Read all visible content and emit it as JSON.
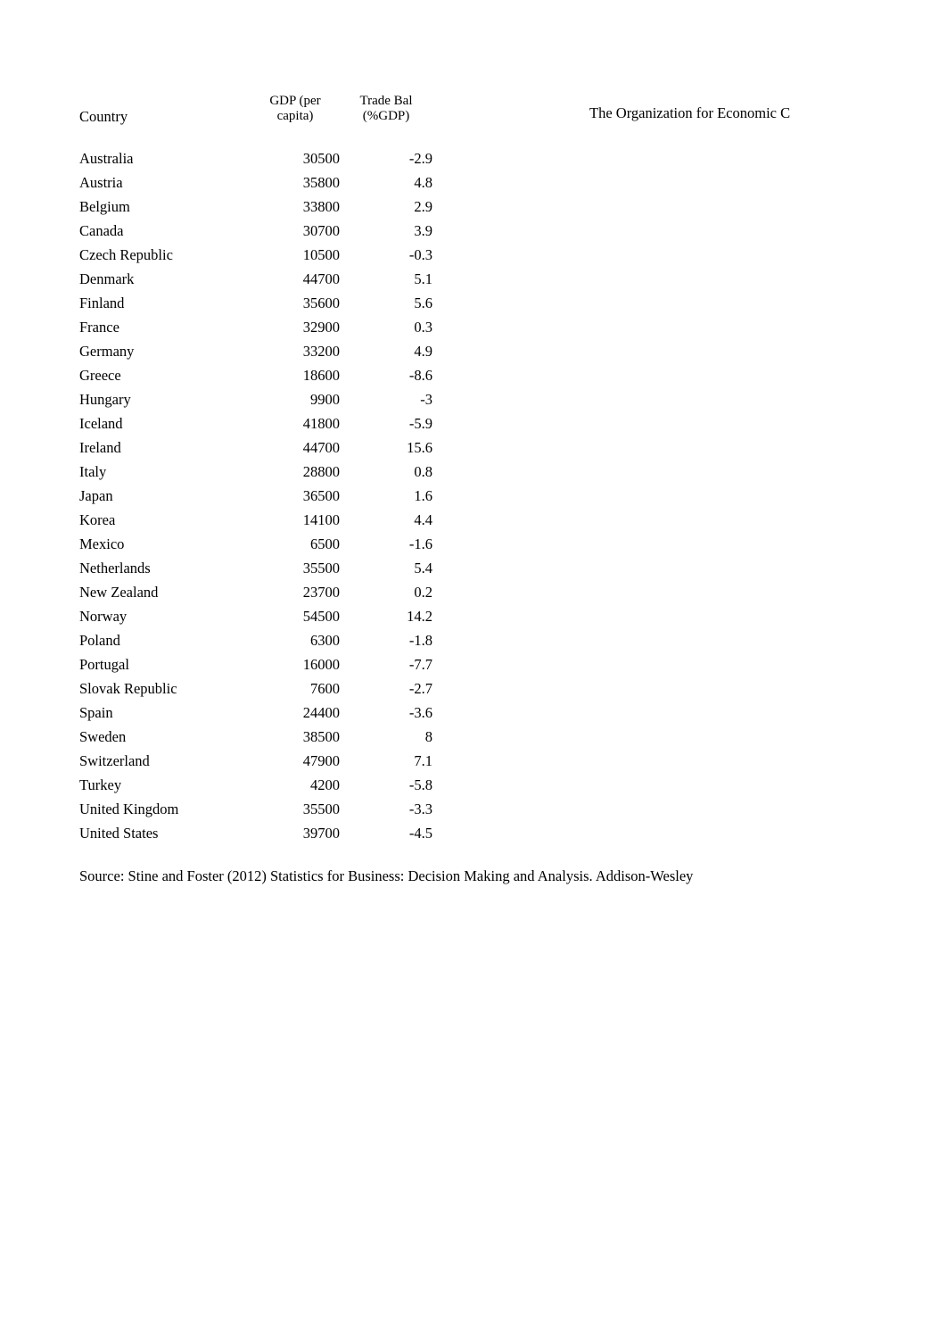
{
  "document": {
    "side_note": "The Organization for Economic C",
    "source": "Source: Stine and Foster (2012) Statistics for Business: Decision Making and Analysis. Addison-Wesley"
  },
  "table": {
    "headers": {
      "country": "Country",
      "gdp_line1": "GDP (per",
      "gdp_line2": "capita)",
      "trade_line1": "Trade Bal",
      "trade_line2": "(%GDP)"
    },
    "rows": [
      {
        "country": "Australia",
        "gdp": "30500",
        "trade": "-2.9"
      },
      {
        "country": "Austria",
        "gdp": "35800",
        "trade": "4.8"
      },
      {
        "country": "Belgium",
        "gdp": "33800",
        "trade": "2.9"
      },
      {
        "country": "Canada",
        "gdp": "30700",
        "trade": "3.9"
      },
      {
        "country": "Czech Republic",
        "gdp": "10500",
        "trade": "-0.3"
      },
      {
        "country": "Denmark",
        "gdp": "44700",
        "trade": "5.1"
      },
      {
        "country": "Finland",
        "gdp": "35600",
        "trade": "5.6"
      },
      {
        "country": "France",
        "gdp": "32900",
        "trade": "0.3"
      },
      {
        "country": "Germany",
        "gdp": "33200",
        "trade": "4.9"
      },
      {
        "country": "Greece",
        "gdp": "18600",
        "trade": "-8.6"
      },
      {
        "country": "Hungary",
        "gdp": "9900",
        "trade": "-3"
      },
      {
        "country": "Iceland",
        "gdp": "41800",
        "trade": "-5.9"
      },
      {
        "country": "Ireland",
        "gdp": "44700",
        "trade": "15.6"
      },
      {
        "country": "Italy",
        "gdp": "28800",
        "trade": "0.8"
      },
      {
        "country": "Japan",
        "gdp": "36500",
        "trade": "1.6"
      },
      {
        "country": "Korea",
        "gdp": "14100",
        "trade": "4.4"
      },
      {
        "country": "Mexico",
        "gdp": "6500",
        "trade": "-1.6"
      },
      {
        "country": "Netherlands",
        "gdp": "35500",
        "trade": "5.4"
      },
      {
        "country": "New Zealand",
        "gdp": "23700",
        "trade": "0.2"
      },
      {
        "country": "Norway",
        "gdp": "54500",
        "trade": "14.2"
      },
      {
        "country": "Poland",
        "gdp": "6300",
        "trade": "-1.8"
      },
      {
        "country": "Portugal",
        "gdp": "16000",
        "trade": "-7.7"
      },
      {
        "country": "Slovak Republic",
        "gdp": "7600",
        "trade": "-2.7"
      },
      {
        "country": "Spain",
        "gdp": "24400",
        "trade": "-3.6"
      },
      {
        "country": "Sweden",
        "gdp": "38500",
        "trade": "8"
      },
      {
        "country": "Switzerland",
        "gdp": "47900",
        "trade": "7.1"
      },
      {
        "country": "Turkey",
        "gdp": "4200",
        "trade": "-5.8"
      },
      {
        "country": "United Kingdom",
        "gdp": "35500",
        "trade": "-3.3"
      },
      {
        "country": "United States",
        "gdp": "39700",
        "trade": "-4.5"
      }
    ]
  },
  "chart_data": {
    "type": "table",
    "title": "",
    "columns": [
      "Country",
      "GDP (per capita)",
      "Trade Bal (%GDP)"
    ],
    "categories": [
      "Australia",
      "Austria",
      "Belgium",
      "Canada",
      "Czech Republic",
      "Denmark",
      "Finland",
      "France",
      "Germany",
      "Greece",
      "Hungary",
      "Iceland",
      "Ireland",
      "Italy",
      "Japan",
      "Korea",
      "Mexico",
      "Netherlands",
      "New Zealand",
      "Norway",
      "Poland",
      "Portugal",
      "Slovak Republic",
      "Spain",
      "Sweden",
      "Switzerland",
      "Turkey",
      "United Kingdom",
      "United States"
    ],
    "series": [
      {
        "name": "GDP (per capita)",
        "values": [
          30500,
          35800,
          33800,
          30700,
          10500,
          44700,
          35600,
          32900,
          33200,
          18600,
          9900,
          41800,
          44700,
          28800,
          36500,
          14100,
          6500,
          35500,
          23700,
          54500,
          6300,
          16000,
          7600,
          24400,
          38500,
          47900,
          4200,
          35500,
          39700
        ]
      },
      {
        "name": "Trade Bal (%GDP)",
        "values": [
          -2.9,
          4.8,
          2.9,
          3.9,
          -0.3,
          5.1,
          5.6,
          0.3,
          4.9,
          -8.6,
          -3,
          -5.9,
          15.6,
          0.8,
          1.6,
          4.4,
          -1.6,
          5.4,
          0.2,
          14.2,
          -1.8,
          -7.7,
          -2.7,
          -3.6,
          8,
          7.1,
          -5.8,
          -3.3,
          -4.5
        ]
      }
    ]
  }
}
